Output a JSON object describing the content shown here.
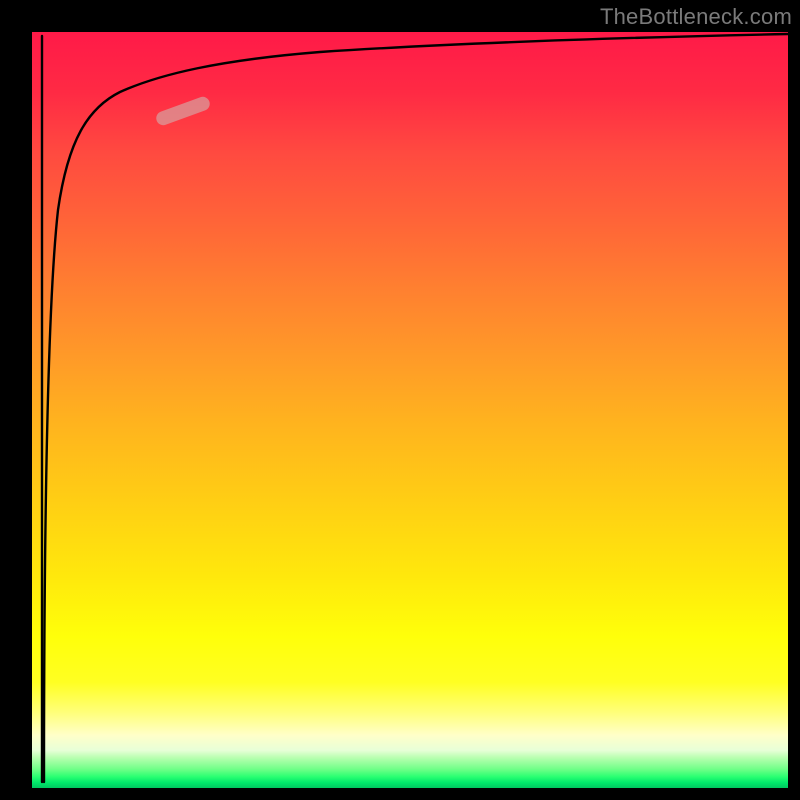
{
  "watermark": {
    "text": "TheBottleneck.com"
  },
  "chart_data": {
    "type": "line",
    "title": "",
    "xlabel": "",
    "ylabel": "",
    "xlim": [
      0,
      100
    ],
    "ylim": [
      0,
      100
    ],
    "grid": false,
    "legend": false,
    "background_gradient": {
      "orientation": "vertical",
      "stops": [
        {
          "pos": 0.0,
          "color": "#ff1a48"
        },
        {
          "pos": 0.5,
          "color": "#ffb41e"
        },
        {
          "pos": 0.8,
          "color": "#ffff0a"
        },
        {
          "pos": 0.95,
          "color": "#e8ffd8"
        },
        {
          "pos": 1.0,
          "color": "#00c860"
        }
      ],
      "note": "red at top (high y), green at bottom (low y)"
    },
    "series": [
      {
        "name": "curve",
        "x": [
          0.0,
          0.5,
          1.0,
          1.5,
          2.0,
          3.0,
          4.0,
          6.0,
          8.0,
          12.0,
          16.0,
          24.0,
          40.0,
          60.0,
          80.0,
          100.0
        ],
        "y": [
          0.0,
          30.0,
          55.0,
          68.0,
          75.0,
          82.0,
          86.0,
          89.5,
          91.0,
          92.8,
          93.8,
          95.0,
          96.2,
          97.0,
          97.6,
          98.0
        ]
      }
    ],
    "highlight": {
      "description": "short pill marker on curve",
      "x_range": [
        16.5,
        23.5
      ],
      "y_range": [
        87.5,
        89.3
      ],
      "color": "rgba(216,158,158,0.72)"
    }
  }
}
